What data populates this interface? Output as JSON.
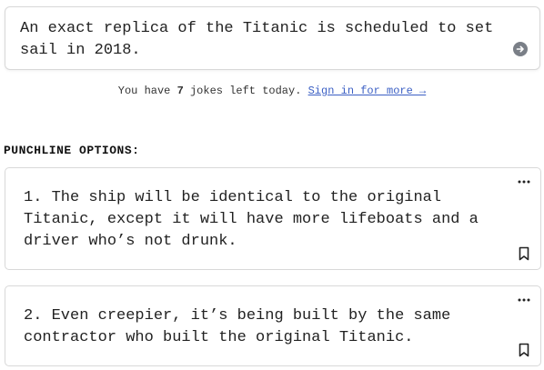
{
  "prompt": {
    "text": "An exact replica of the Titanic is scheduled to set sail in 2018.",
    "submit_icon": "arrow-right-circle-icon"
  },
  "quota": {
    "prefix": "You have ",
    "count": "7",
    "suffix": " jokes left today.",
    "link_label": "Sign in for more →"
  },
  "punchlines": {
    "title": "PUNCHLINE OPTIONS:",
    "items": [
      {
        "text": "1. The ship will be identical to the original Titanic, except it will have more lifeboats and a driver who’s not drunk."
      },
      {
        "text": "2. Even creepier, it’s being built by the same contractor who built the original Titanic."
      }
    ]
  },
  "colors": {
    "link": "#3b5fc4",
    "icon": "#7a7f87",
    "border": "#d8d8d8"
  }
}
